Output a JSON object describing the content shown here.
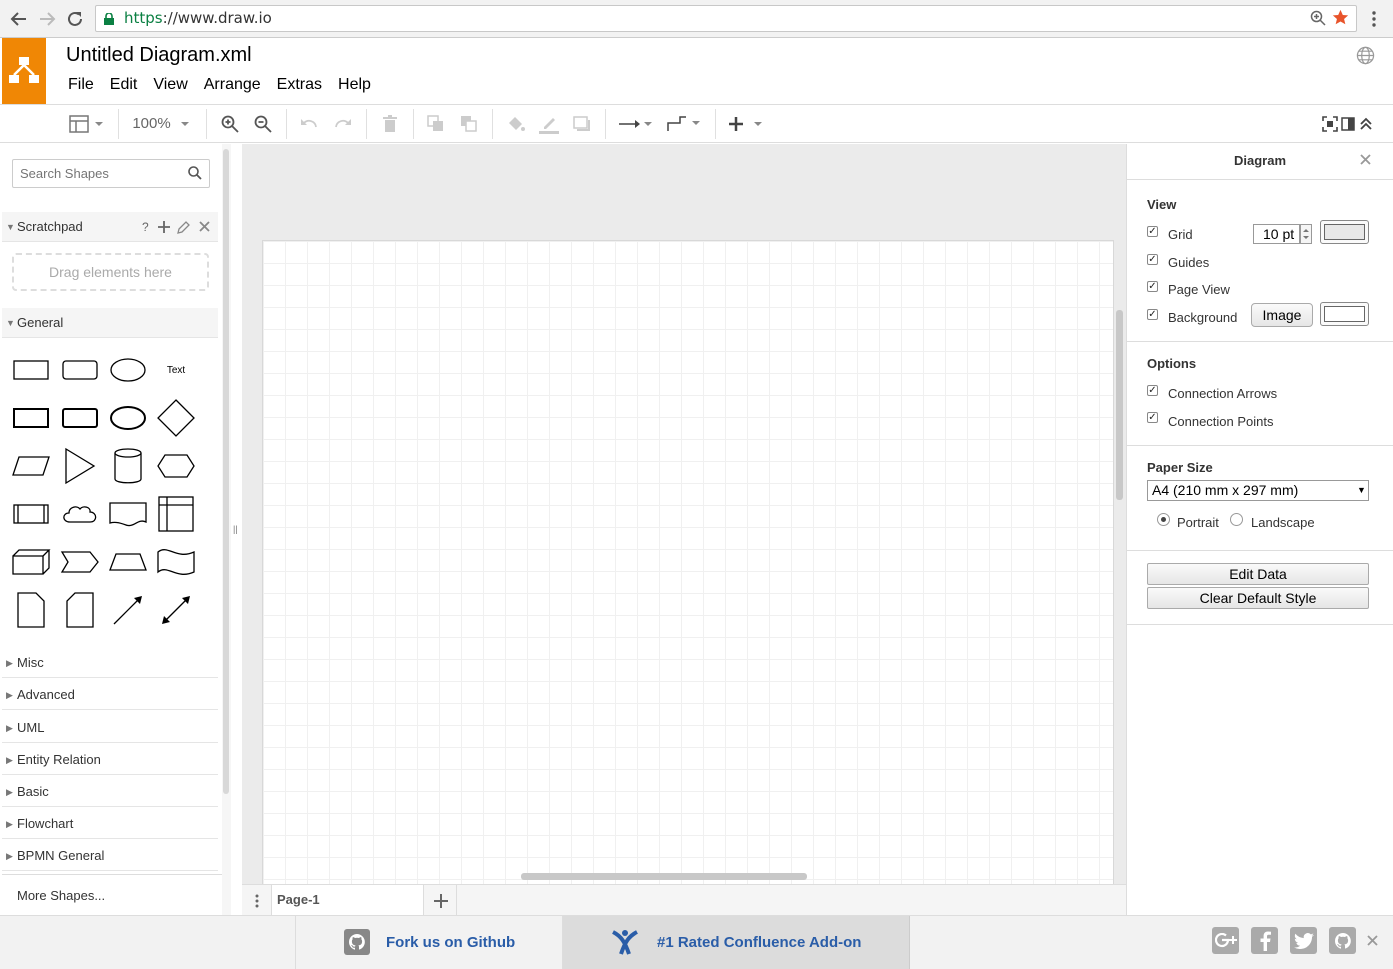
{
  "browser": {
    "url_scheme": "https",
    "url_rest": "://www.draw.io"
  },
  "app": {
    "title": "Untitled Diagram.xml",
    "brand_color": "#f08705"
  },
  "menu": [
    "File",
    "Edit",
    "View",
    "Arrange",
    "Extras",
    "Help"
  ],
  "toolbar": {
    "zoom": "100%"
  },
  "left_panel": {
    "search_placeholder": "Search Shapes",
    "scratchpad": {
      "title": "Scratchpad",
      "help": "?",
      "drop_hint": "Drag elements here"
    },
    "general": {
      "title": "General",
      "text_shape_label": "Text"
    },
    "sections": [
      "Misc",
      "Advanced",
      "UML",
      "Entity Relation",
      "Basic",
      "Flowchart",
      "BPMN General"
    ],
    "more_shapes": "More Shapes..."
  },
  "pages": {
    "current": "Page-1"
  },
  "format_panel": {
    "title": "Diagram",
    "view_heading": "View",
    "grid_label": "Grid",
    "grid_size": "10 pt",
    "guides_label": "Guides",
    "page_view_label": "Page View",
    "background_label": "Background",
    "image_button": "Image",
    "options_heading": "Options",
    "connection_arrows_label": "Connection Arrows",
    "connection_points_label": "Connection Points",
    "paper_size_heading": "Paper Size",
    "paper_size": "A4 (210 mm x 297 mm)",
    "portrait_label": "Portrait",
    "landscape_label": "Landscape",
    "orientation": "Portrait",
    "edit_data_button": "Edit Data",
    "clear_style_button": "Clear Default Style",
    "checked": {
      "grid": true,
      "guides": true,
      "page_view": true,
      "background": true,
      "connection_arrows": true,
      "connection_points": true
    }
  },
  "footer": {
    "github_link": "Fork us on Github",
    "confluence_link": "#1 Rated Confluence Add-on",
    "link_color": "#2a5da8"
  }
}
